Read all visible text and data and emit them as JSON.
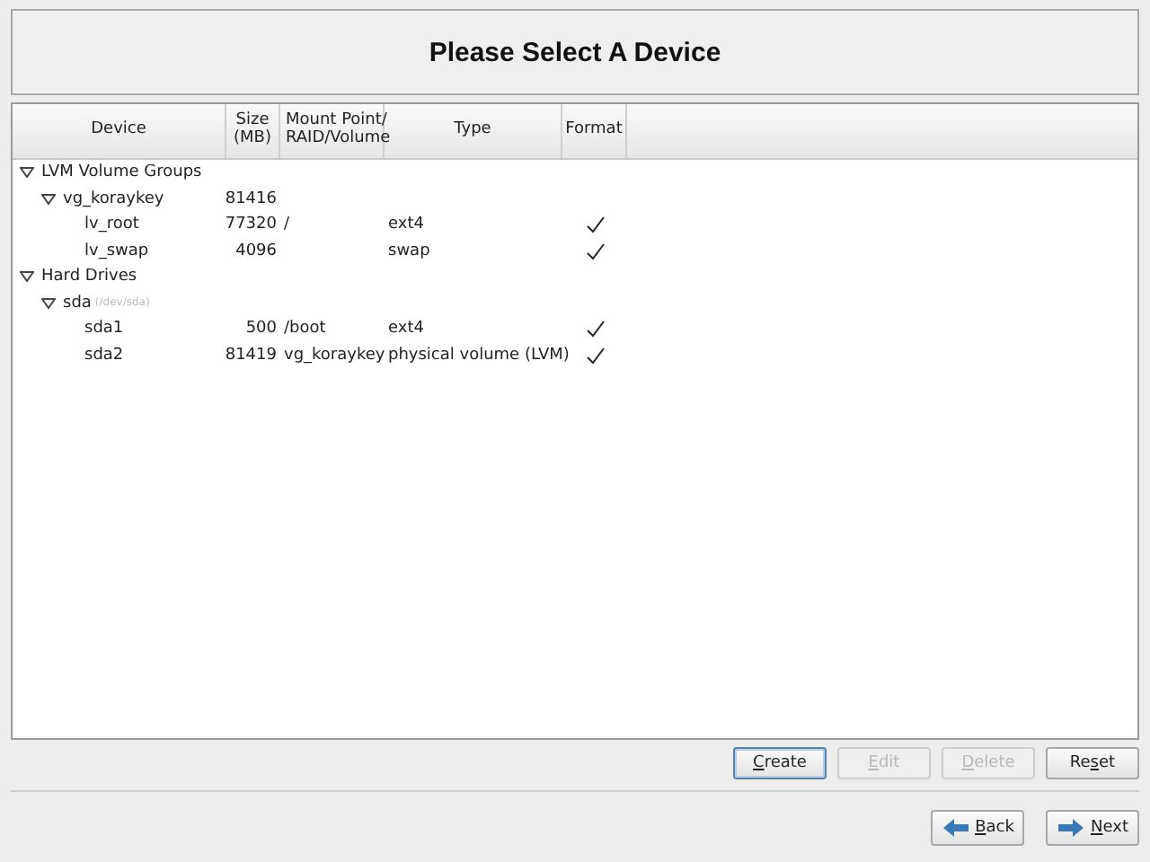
{
  "header": {
    "title": "Please Select A Device"
  },
  "table": {
    "columns": [
      "Device",
      "Size\n(MB)",
      "Mount Point/\nRAID/Volume",
      "Type",
      "Format"
    ],
    "rows": [
      {
        "device": "LVM Volume Groups",
        "expanded": true,
        "children": [
          {
            "device": "vg_koraykey",
            "size": "81416",
            "expanded": true,
            "children": [
              {
                "device": "lv_root",
                "size": "77320",
                "mount": "/",
                "type": "ext4",
                "format": true
              },
              {
                "device": "lv_swap",
                "size": "4096",
                "type": "swap",
                "format": true
              }
            ]
          }
        ]
      },
      {
        "device": "Hard Drives",
        "expanded": true,
        "children": [
          {
            "device": "sda",
            "note": "(/dev/sda)",
            "expanded": true,
            "children": [
              {
                "device": "sda1",
                "size": "500",
                "mount": "/boot",
                "type": "ext4",
                "format": true
              },
              {
                "device": "sda2",
                "size": "81419",
                "mount": "vg_koraykey",
                "type": "physical volume (LVM)",
                "format": true
              }
            ]
          }
        ]
      }
    ]
  },
  "actions": [
    {
      "key": "C",
      "after": "reate",
      "disabled": false,
      "focused": true
    },
    {
      "key": "E",
      "after": "dit",
      "disabled": true,
      "focused": false
    },
    {
      "key": "D",
      "after": "elete",
      "disabled": true,
      "focused": false
    },
    {
      "before": "Re",
      "key": "s",
      "after": "et",
      "disabled": false,
      "focused": false
    }
  ],
  "navigation": [
    {
      "kind": "back",
      "key": "B",
      "after": "ack"
    },
    {
      "kind": "next",
      "key": "N",
      "after": "ext"
    }
  ]
}
